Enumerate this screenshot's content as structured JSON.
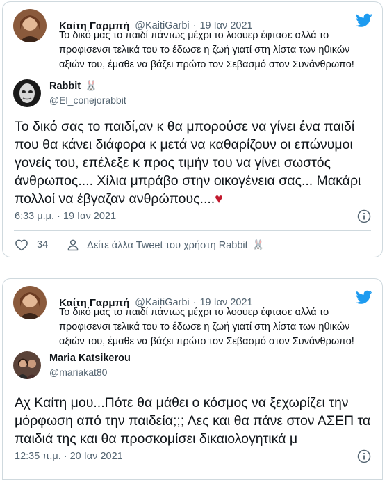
{
  "tweets": [
    {
      "quoted": {
        "name": "Καίτη Γαρμπή",
        "handle": "@KaitiGarbi",
        "sep": "·",
        "date": "19 Ιαν 2021",
        "text": "Το δικό μας το παιδί πάντως μέχρι το λοουερ έφτασε αλλά το προφισενσι τελικά του το έδωσε η ζωή γιατί στη λίστα των ηθικών αξιών του, έμαθε να βάζει πρώτο τον Σεβασμό στον Συνάνθρωπο!",
        "avatar_icon": "profile-photo"
      },
      "reply": {
        "name": "Rabbit",
        "emoji": "🐰",
        "handle": "@El_conejorabbit",
        "text": "Το δικό σας το παιδί,αν κ θα μπορούσε να γίνει ένα παιδί που θα κάνει διάφορα κ μετά να καθαρίζουν οι επώνυμοι γονείς του, επέλεξε κ προς τιμήν του να γίνει σωστός άνθρωπος.... Χίλια μπράβο στην οικογένεια σας... Μακάρι πολλοί να έβγαζαν ανθρώπους....",
        "heart": "♥",
        "timestamp": "6:33 μ.μ. · 19 Ιαν 2021",
        "likes": "34",
        "more_label": "Δείτε άλλα Tweet του χρήστη Rabbit",
        "more_emoji": "🐰"
      }
    },
    {
      "quoted": {
        "name": "Καίτη Γαρμπή",
        "handle": "@KaitiGarbi",
        "sep": "·",
        "date": "19 Ιαν 2021",
        "text": "Το δικό μας το παιδί πάντως μέχρι το λοουερ έφτασε αλλά το προφισενσι τελικά του το έδωσε η ζωή γιατί στη λίστα των ηθικών αξιών του, έμαθε να βάζει πρώτο τον Σεβασμό στον Συνάνθρωπο!",
        "avatar_icon": "profile-photo"
      },
      "reply": {
        "name": "Maria Katsikerou",
        "handle": "@mariakat80",
        "text": "Αχ Καίτη μου...Πότε θα μάθει ο κόσμος να ξεχωρίζει την μόρφωση από την παιδεία;;; Λες και θα πάνε στον ΑΣΕΠ τα παιδιά της και  θα προσκομίσει δικαιολογητικά μ",
        "timestamp": "12:35 π.μ. · 20 Ιαν 2021"
      }
    }
  ],
  "icons": {
    "brand": "twitter-bird",
    "like": "heart-outline",
    "profile": "person-outline",
    "info": "info-circle"
  },
  "colors": {
    "brand": "#1d9bf0",
    "secondary_text": "#536471",
    "border": "#cfd9de",
    "heart": "#c21a2e"
  }
}
